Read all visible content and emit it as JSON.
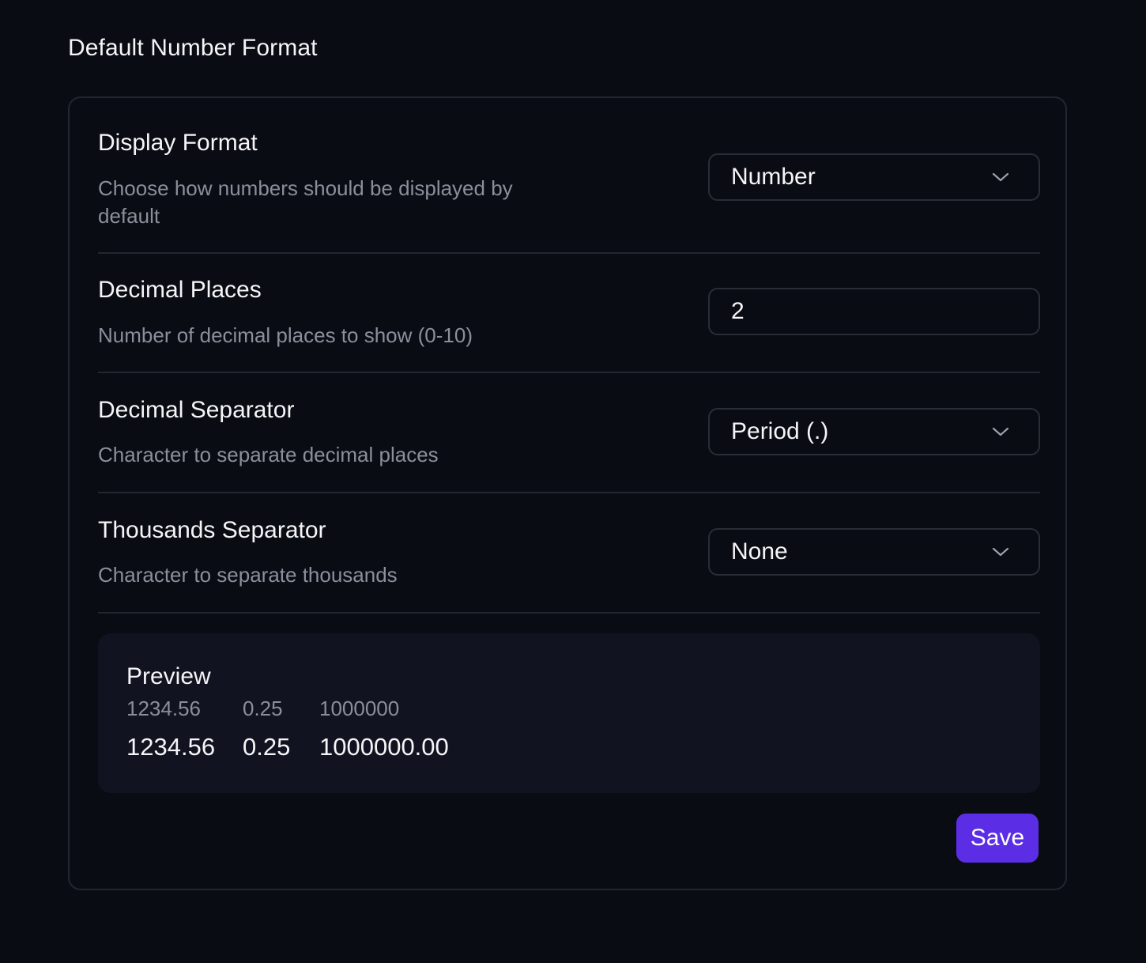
{
  "page": {
    "title": "Default Number Format"
  },
  "settings": [
    {
      "title": "Display Format",
      "description": "Choose how numbers should be displayed by default",
      "control": "select",
      "value": "Number",
      "icon": "chevron-down-icon"
    },
    {
      "title": "Decimal Places",
      "description": "Number of decimal places to show (0-10)",
      "control": "input",
      "value": "2"
    },
    {
      "title": "Decimal Separator",
      "description": "Character to separate decimal places",
      "control": "select",
      "value": "Period (.)",
      "icon": "chevron-down-icon"
    },
    {
      "title": "Thousands Separator",
      "description": "Character to separate thousands",
      "control": "select",
      "value": "None",
      "icon": "chevron-down-icon"
    }
  ],
  "preview": {
    "title": "Preview",
    "examples": [
      {
        "input": "1234.56",
        "output": "1234.56"
      },
      {
        "input": "0.25",
        "output": "0.25"
      },
      {
        "input": "1000000",
        "output": "1000000.00"
      }
    ]
  },
  "actions": {
    "save_label": "Save"
  },
  "colors": {
    "background": "#0a0c14",
    "border": "#23262f",
    "muted_text": "#8b8f9a",
    "preview_bg": "#111420",
    "accent": "#5b2ee6"
  }
}
